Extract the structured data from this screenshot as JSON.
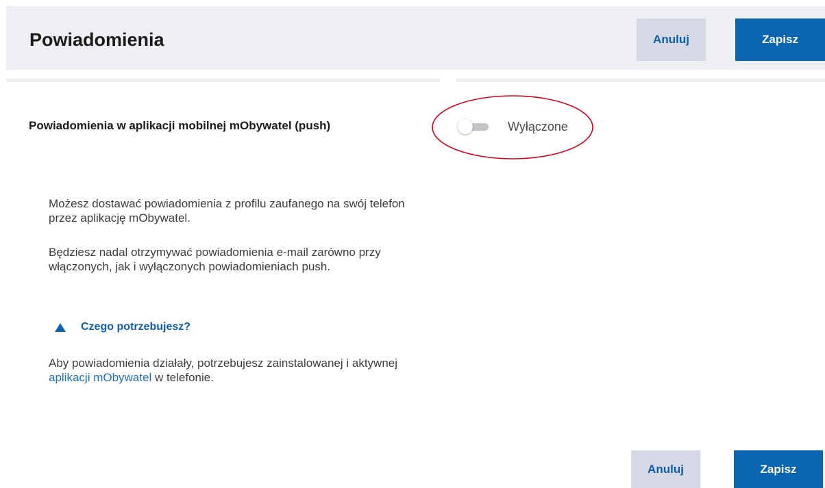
{
  "header": {
    "title": "Powiadomienia",
    "cancel_label": "Anuluj",
    "save_label": "Zapisz"
  },
  "push_setting": {
    "label": "Powiadomienia w aplikacji mobilnej mObywatel (push)",
    "enabled": false,
    "state_label": "Wyłączone"
  },
  "info": {
    "paragraph_1": "Możesz dostawać powiadomienia z profilu zaufanego na swój telefon przez aplikację mObywatel.",
    "paragraph_2": "Będziesz nadal otrzymywać powiadomienia e-mail zarówno przy włączonych, jak i wyłączonych powiadomieniach push.",
    "expander_label": "Czego potrzebujesz?",
    "paragraph_3_before": "Aby powiadomienia działały, potrzebujesz zainstalowanej i aktywnej ",
    "paragraph_3_link": "aplikacji mObywatel",
    "paragraph_3_after": " w telefonie."
  },
  "footer": {
    "cancel_label": "Anuluj",
    "save_label": "Zapisz"
  },
  "colors": {
    "primary": "#0b66b2",
    "secondary_button": "#d5d8e5",
    "header_bg": "#eeeff3",
    "annotation": "#d0021b"
  }
}
